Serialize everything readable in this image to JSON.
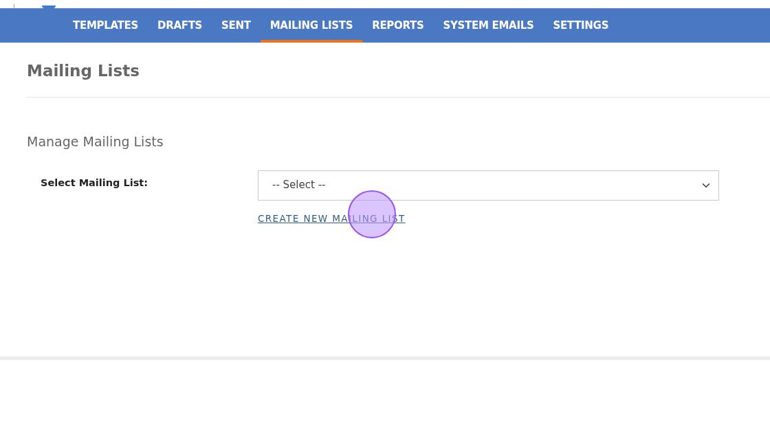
{
  "nav": {
    "tabs": [
      {
        "label": "TEMPLATES",
        "selected": false
      },
      {
        "label": "DRAFTS",
        "selected": false
      },
      {
        "label": "SENT",
        "selected": false
      },
      {
        "label": "MAILING LISTS",
        "selected": true
      },
      {
        "label": "REPORTS",
        "selected": false
      },
      {
        "label": "SYSTEM EMAILS",
        "selected": false
      },
      {
        "label": "SETTINGS",
        "selected": false
      }
    ]
  },
  "page_title": "Mailing Lists",
  "section_title": "Manage Mailing Lists",
  "form": {
    "label": "Select Mailing List:",
    "select": {
      "value": "-- Select --"
    },
    "link": "CREATE NEW MAILING LIST"
  }
}
